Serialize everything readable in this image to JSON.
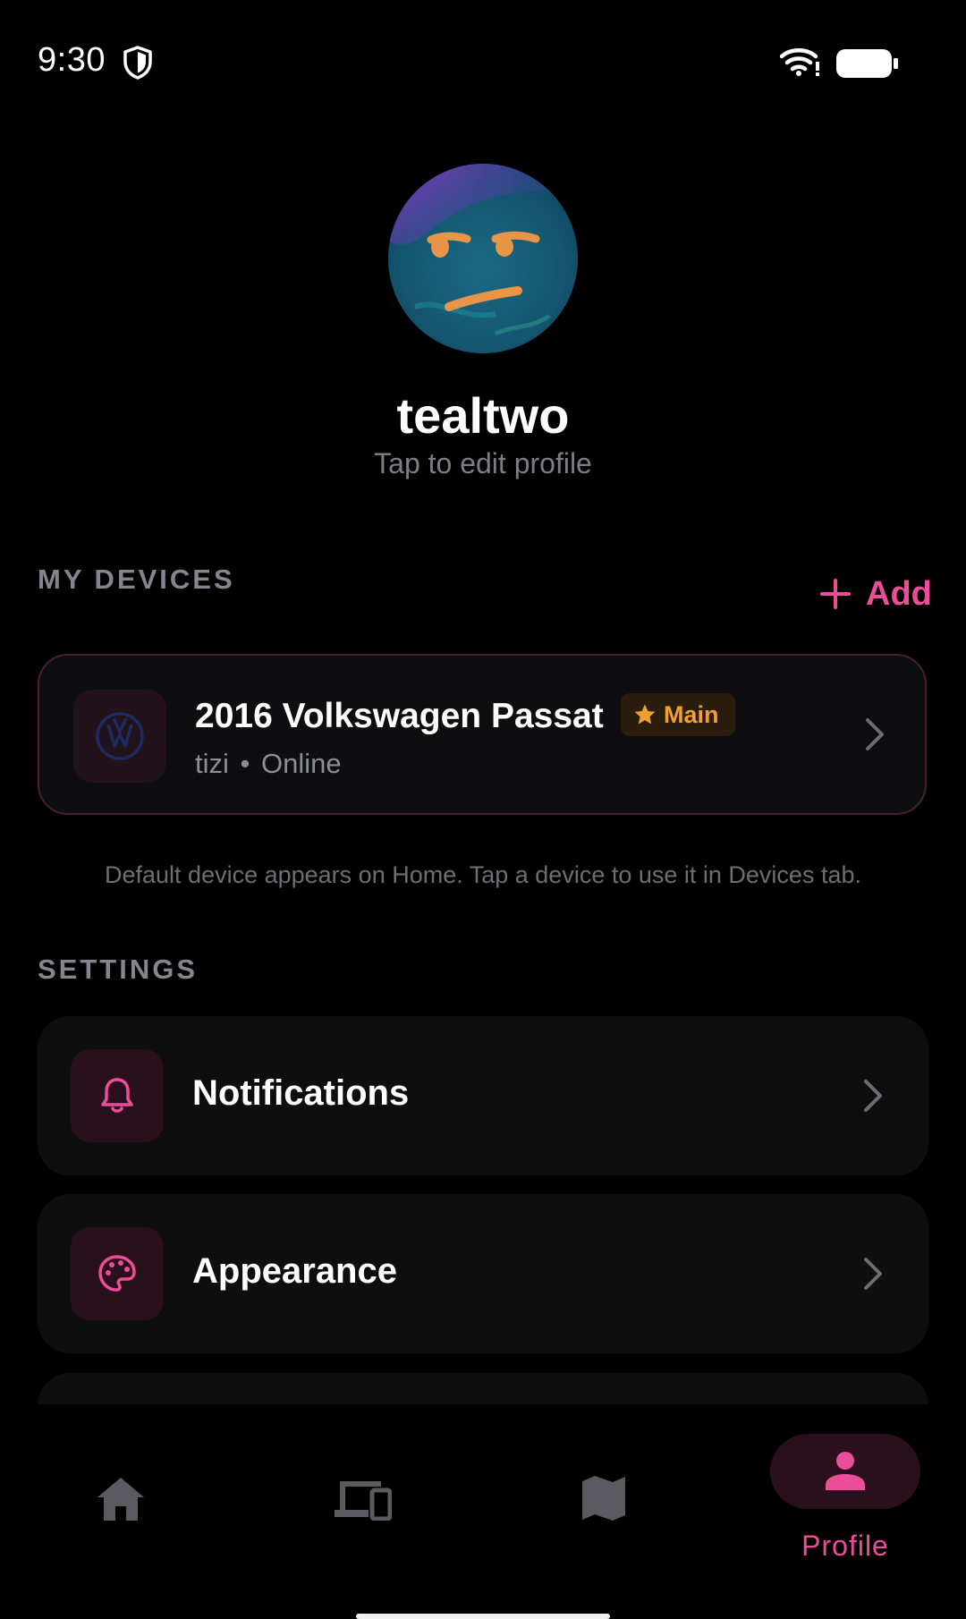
{
  "status_bar": {
    "time": "9:30"
  },
  "profile": {
    "username": "tealtwo",
    "edit_hint": "Tap to edit profile"
  },
  "devices_section": {
    "title": "MY DEVICES",
    "add_label": "Add",
    "note": "Default device appears on Home. Tap a device to use it in Devices tab."
  },
  "device": {
    "name": "2016 Volkswagen Passat",
    "badge": "Main",
    "model": "tizi",
    "separator": "•",
    "status": "Online"
  },
  "settings_section": {
    "title": "SETTINGS",
    "items": [
      {
        "label": "Notifications",
        "icon": "bell-icon"
      },
      {
        "label": "Appearance",
        "icon": "palette-icon"
      }
    ]
  },
  "bottom_nav": {
    "items": [
      {
        "icon": "home-icon",
        "active": false
      },
      {
        "icon": "devices-icon",
        "active": false
      },
      {
        "icon": "map-icon",
        "active": false
      },
      {
        "icon": "person-icon",
        "active": true,
        "label": "Profile"
      }
    ]
  },
  "colors": {
    "accent": "#ec4d98",
    "badge_text": "#f0a030",
    "background": "#000000",
    "card": "#0e0e0f"
  }
}
